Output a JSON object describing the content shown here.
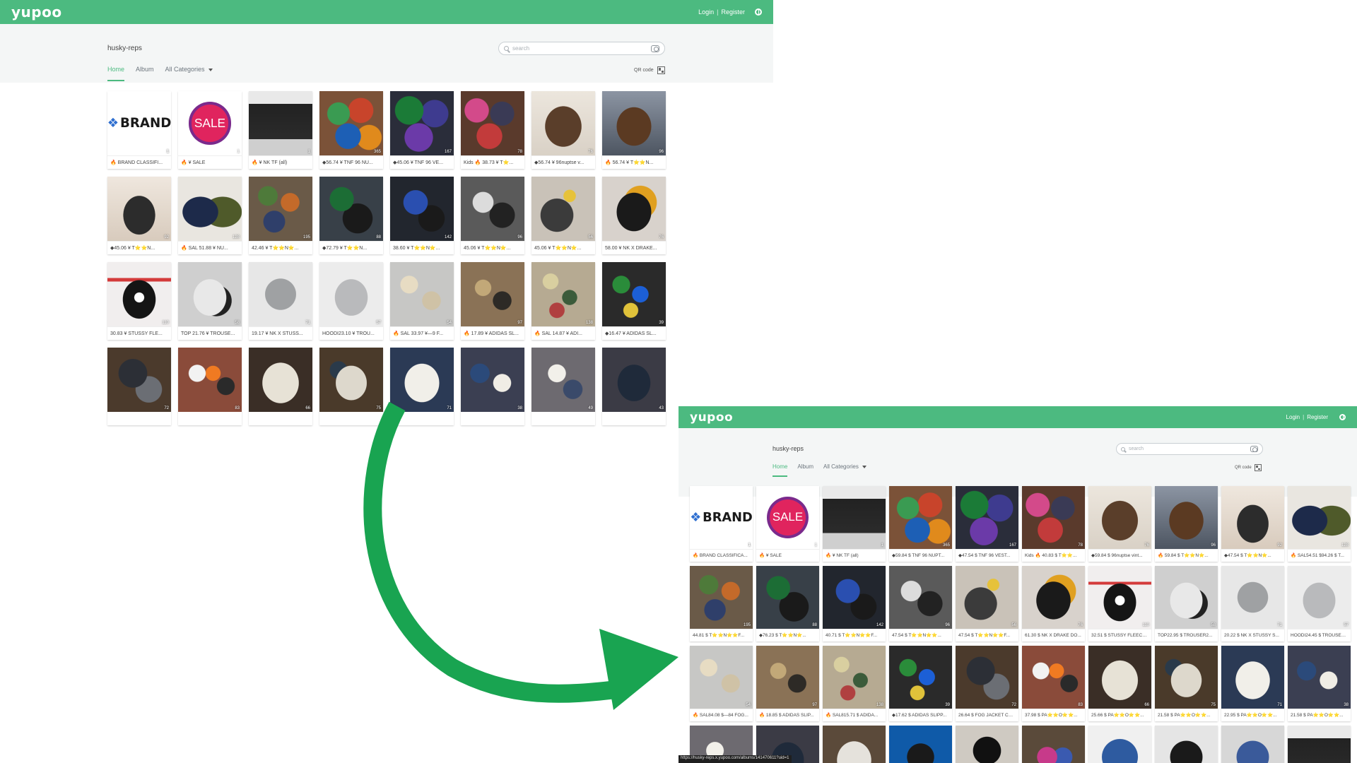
{
  "header": {
    "logo": "yupoo",
    "login": "Login",
    "separator": "|",
    "register": "Register"
  },
  "store": {
    "name": "husky-reps",
    "search_placeholder": "search",
    "tabs": [
      "Home",
      "Album",
      "All Categories"
    ],
    "active_tab": "Home",
    "qr_label": "QR code"
  },
  "colors": {
    "brand_green": "#4cba80",
    "subheader_bg": "#f4f6f6",
    "arrow": "#19a451"
  },
  "top_albums": [
    {
      "count": "1",
      "caption": "🔥 BRAND CLASSIFI..."
    },
    {
      "count": "1",
      "caption": "🔥 ¥ SALE"
    },
    {
      "count": "1",
      "caption": "🔥 ¥ NK TF (all)"
    },
    {
      "count": "365",
      "caption": "◆56.74 ¥ TNF 96 NU..."
    },
    {
      "count": "167",
      "caption": "◆45.06 ¥ TNF 96 VE..."
    },
    {
      "count": "78",
      "caption": "Kids 🔥 38.73 ¥ T⭐..."
    },
    {
      "count": "76",
      "caption": "◆56.74 ¥ 96nuptse v..."
    },
    {
      "count": "96",
      "caption": "🔥 56.74 ¥ T⭐⭐N..."
    },
    {
      "count": "92",
      "caption": "◆45.06 ¥ T⭐⭐N..."
    },
    {
      "count": "128",
      "caption": "🔥 SAL 51.88 ¥ NU..."
    },
    {
      "count": "195",
      "caption": "42.46 ¥ T⭐⭐N⭐..."
    },
    {
      "count": "88",
      "caption": "◆72.79 ¥ T⭐⭐N..."
    },
    {
      "count": "142",
      "caption": "38.60 ¥ T⭐⭐N⭐..."
    },
    {
      "count": "96",
      "caption": "45.06 ¥ T⭐⭐N⭐..."
    },
    {
      "count": "56",
      "caption": "45.06 ¥ T⭐⭐N⭐..."
    },
    {
      "count": "76",
      "caption": "58.00 ¥ NK X DRAKE..."
    },
    {
      "count": "110",
      "caption": "30.83 ¥ STUSSY FLE..."
    },
    {
      "count": "58",
      "caption": "TOP 21.76 ¥ TROUSE..."
    },
    {
      "count": "71",
      "caption": "19.17 ¥ NK X STUSS..."
    },
    {
      "count": "57",
      "caption": "HOODI23.10 ¥ TROU..."
    },
    {
      "count": "54",
      "caption": "🔥 SAL 33.97 ¥—9 F..."
    },
    {
      "count": "97",
      "caption": "🔥 17.89 ¥ ADIDAS SL..."
    },
    {
      "count": "138",
      "caption": "🔥 SAL 14.87 ¥ ADI..."
    },
    {
      "count": "39",
      "caption": "◆16.47 ¥ ADIDAS SL..."
    },
    {
      "count": "72",
      "caption": ""
    },
    {
      "count": "83",
      "caption": ""
    },
    {
      "count": "66",
      "caption": ""
    },
    {
      "count": "75",
      "caption": ""
    },
    {
      "count": "71",
      "caption": ""
    },
    {
      "count": "38",
      "caption": ""
    },
    {
      "count": "49",
      "caption": ""
    },
    {
      "count": "43",
      "caption": ""
    }
  ],
  "bottom_albums": [
    {
      "count": "1",
      "caption": "🔥 BRAND CLASSIFICA..."
    },
    {
      "count": "1",
      "caption": "🔥 ¥ SALE"
    },
    {
      "count": "1",
      "caption": "🔥 ¥ NK TF (all)"
    },
    {
      "count": "365",
      "caption": "◆59.84 $ TNF 96 NUPT..."
    },
    {
      "count": "167",
      "caption": "◆47.54 $ TNF 96 VEST..."
    },
    {
      "count": "78",
      "caption": "Kids 🔥 40.83 $ T⭐⭐..."
    },
    {
      "count": "76",
      "caption": "◆59.84 $ 96nuptse vint..."
    },
    {
      "count": "96",
      "caption": "🔥 59.84 $ T⭐⭐N⭐..."
    },
    {
      "count": "92",
      "caption": "◆47.54 $ T⭐⭐N⭐..."
    },
    {
      "count": "128",
      "caption": "🔥 SAL54.51 $94.26 $ T..."
    },
    {
      "count": "195",
      "caption": "44.81 $ T⭐⭐N⭐⭐F..."
    },
    {
      "count": "88",
      "caption": "◆76.23 $ T⭐⭐N⭐..."
    },
    {
      "count": "142",
      "caption": "40.71 $ T⭐⭐N⭐⭐F..."
    },
    {
      "count": "96",
      "caption": "47.54 $ T⭐⭐N⭐⭐..."
    },
    {
      "count": "56",
      "caption": "47.54 $ T⭐⭐N⭐⭐F..."
    },
    {
      "count": "76",
      "caption": "61.30 $ NK X DRAKE DO..."
    },
    {
      "count": "110",
      "caption": "32.51 $ STUSSY FLEECE..."
    },
    {
      "count": "58",
      "caption": "TOP22.95 $ TROUSER2..."
    },
    {
      "count": "71",
      "caption": "20.22 $ NK X STUSSY S..."
    },
    {
      "count": "57",
      "caption": "HOODI24.45 $ TROUSER..."
    },
    {
      "count": "54",
      "caption": "🔥 SAL84.08 $—84 FOG..."
    },
    {
      "count": "97",
      "caption": "🔥 18.85 $ ADIDAS SLIP..."
    },
    {
      "count": "138",
      "caption": "🔥 SAL815.71 $ ADIDA..."
    },
    {
      "count": "39",
      "caption": "◆17.62 $ ADIDAS SLIPP..."
    },
    {
      "count": "72",
      "caption": "26.64 $ FOG JACKET CO..."
    },
    {
      "count": "83",
      "caption": "37.98 $ PA⭐⭐O⭐⭐..."
    },
    {
      "count": "66",
      "caption": "25.66 $ PA⭐⭐O⭐⭐..."
    },
    {
      "count": "75",
      "caption": "21.58 $ PA⭐⭐O⭐⭐..."
    },
    {
      "count": "71",
      "caption": "22.95 $ PA⭐⭐O⭐⭐..."
    },
    {
      "count": "38",
      "caption": "21.58 $ PA⭐⭐O⭐⭐..."
    },
    {
      "count": "",
      "caption": ""
    },
    {
      "count": "",
      "caption": ""
    },
    {
      "count": "",
      "caption": ""
    },
    {
      "count": "",
      "caption": ""
    },
    {
      "count": "",
      "caption": ""
    },
    {
      "count": "",
      "caption": ""
    },
    {
      "count": "",
      "caption": ""
    },
    {
      "count": "",
      "caption": ""
    },
    {
      "count": "",
      "caption": ""
    },
    {
      "count": "",
      "caption": ""
    }
  ],
  "brand_tile": {
    "text": "BRAND"
  },
  "sale_tile": {
    "text": "SALE"
  },
  "status_url": "https://husky-reps.x.yupoo.com/albums/141470611?uid=1"
}
